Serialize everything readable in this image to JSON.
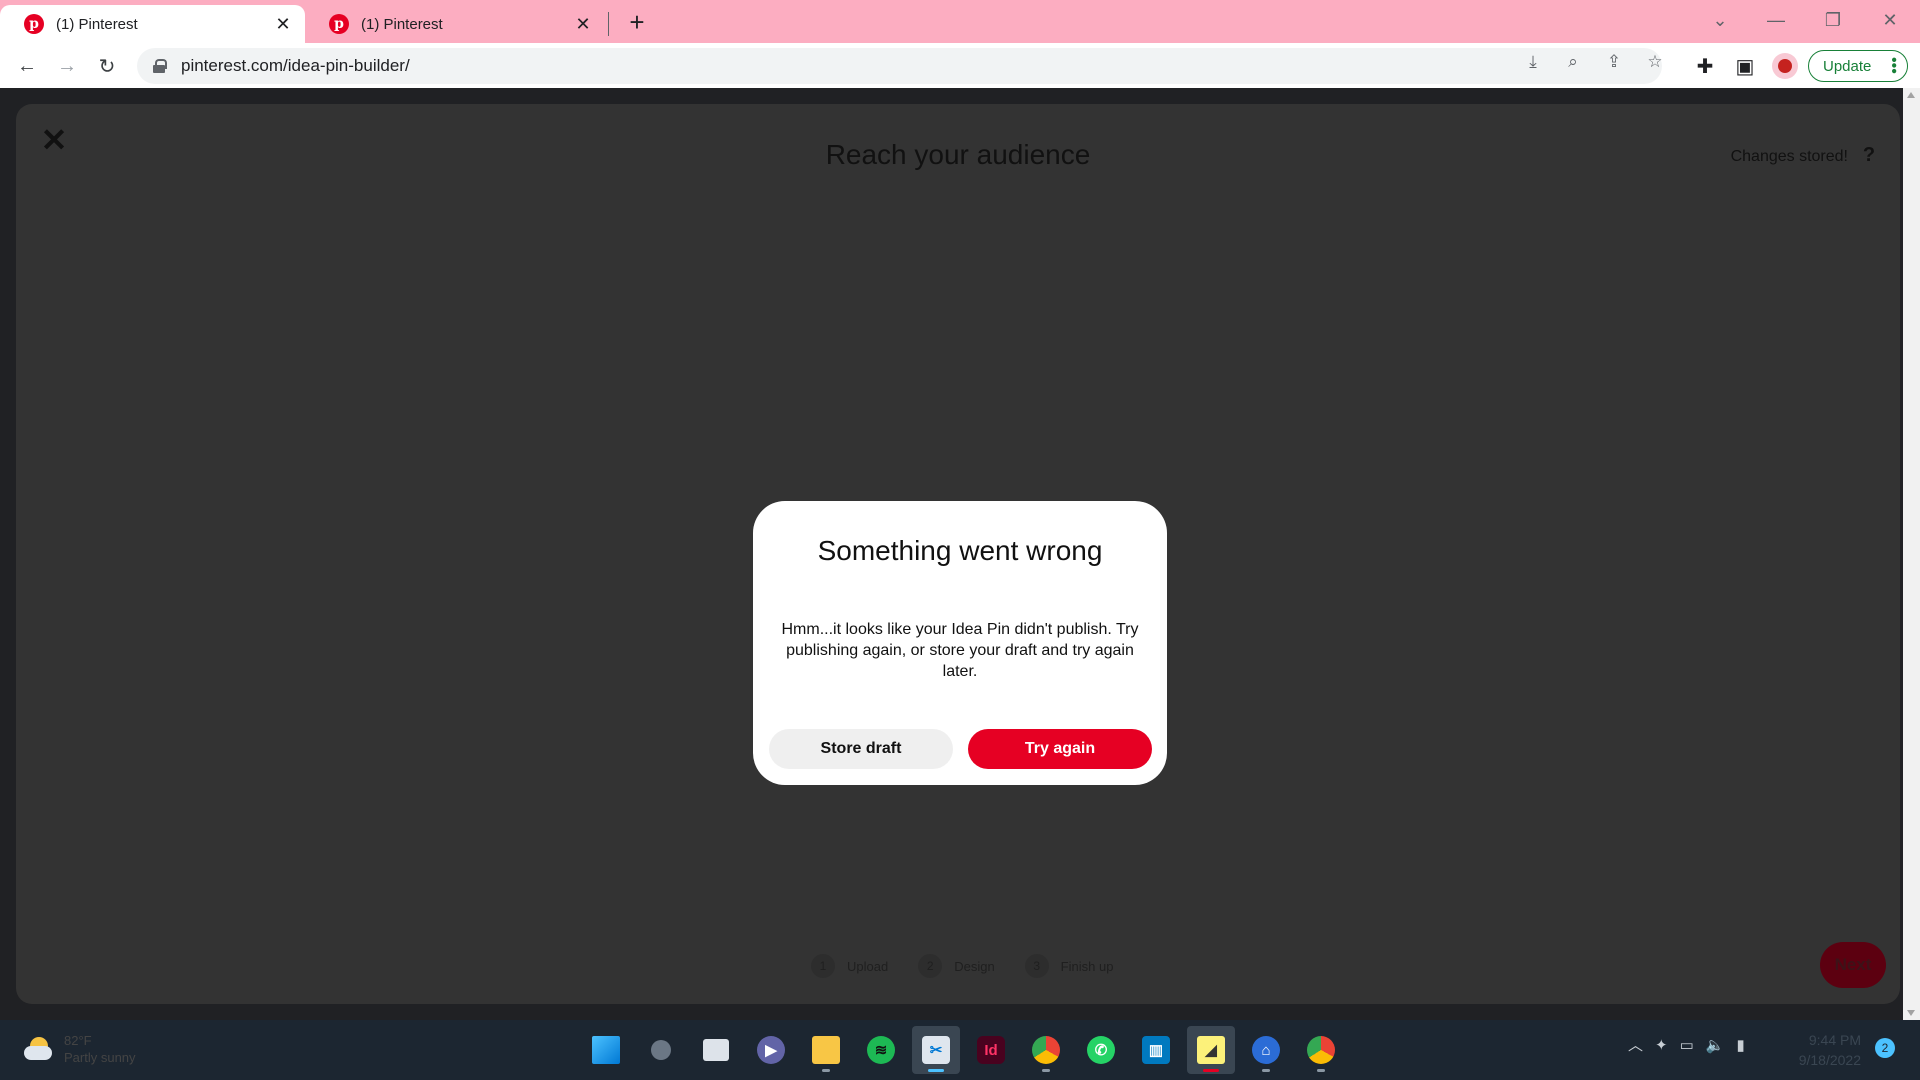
{
  "browser": {
    "tabs": [
      {
        "label": "(1) Pinterest",
        "active": true
      },
      {
        "label": "(1) Pinterest",
        "active": false
      }
    ],
    "url": "pinterest.com/idea-pin-builder/",
    "update_label": "Update"
  },
  "builder": {
    "heading": "Reach your audience",
    "status": "Changes stored!",
    "help_label": "?",
    "steps": [
      {
        "num": "1",
        "label": "Upload"
      },
      {
        "num": "2",
        "label": "Design"
      },
      {
        "num": "3",
        "label": "Finish up"
      }
    ],
    "next_label": "Next"
  },
  "modal": {
    "title": "Something went wrong",
    "body": "Hmm...it looks like your Idea Pin didn't publish. Try publishing again, or store your draft and try again later.",
    "secondary_label": "Store draft",
    "primary_label": "Try again"
  },
  "taskbar": {
    "weather_temp": "82°F",
    "weather_desc": "Partly sunny",
    "time": "9:44 PM",
    "date": "9/18/2022",
    "notifications": "2"
  },
  "colors": {
    "pinterest_red": "#e60023",
    "tab_strip": "#fcadc1",
    "overlay": "#333333"
  }
}
